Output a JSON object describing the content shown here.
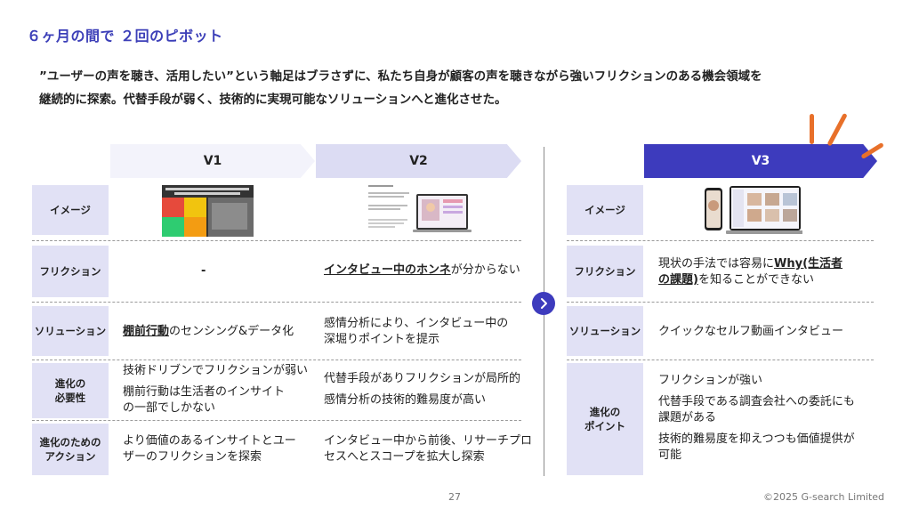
{
  "title": "６ヶ月の間で ２回のピボット",
  "intro": {
    "line1": "”ユーザーの声を聴き、活用したい”という軸足はブラさずに、私たち自身が顧客の声を聴きながら強いフリクションのある機会領域を",
    "line2": "継続的に探索。代替手段が弱く、技術的に実現可能なソリューションへと進化させた。"
  },
  "columns": {
    "v1": "V1",
    "v2": "V2",
    "v3": "V3"
  },
  "left_labels": {
    "image": "イメージ",
    "friction": "フリクション",
    "solution": "ソリューション",
    "necessity_1": "進化の",
    "necessity_2": "必要性",
    "action_1": "進化のための",
    "action_2": "アクション"
  },
  "right_labels": {
    "image": "イメージ",
    "friction": "フリクション",
    "solution": "ソリューション",
    "point_1": "進化の",
    "point_2": "ポイント"
  },
  "v1": {
    "friction": "-",
    "solution_strong": "棚前行動",
    "solution_rest": "のセンシング&データ化",
    "necessity_1": "技術ドリブンでフリクションが弱い",
    "necessity_2a": "棚前行動は生活者のインサイト",
    "necessity_2b": "の一部でしかない",
    "action_a": "より価値のあるインサイトとユー",
    "action_b": "ザーのフリクションを探索"
  },
  "v2": {
    "friction_strong": "インタビュー中のホンネ",
    "friction_rest": "が分からない",
    "solution_a": "感情分析により、インタビュー中の",
    "solution_b": "深堀りポイントを提示",
    "necessity_1": "代替手段がありフリクションが局所的",
    "necessity_2": "感情分析の技術的難易度が高い",
    "action_a": "インタビュー中から前後、リサーチプロ",
    "action_b": "セスへとスコープを拡大し探索"
  },
  "v3": {
    "friction_a_pre": "現状の手法では容易に",
    "friction_a_strong": "Why(生活者",
    "friction_b_strong": "の課題)",
    "friction_b_rest": "を知ることができない",
    "solution": "クイックなセルフ動画インタビュー",
    "point_1": "フリクションが強い",
    "point_2a": "代替手段である調査会社への委託にも",
    "point_2b": "課題がある",
    "point_3a": "技術的難易度を抑えつつも価値提供が",
    "point_3b": "可能"
  },
  "footer": {
    "page": "27",
    "copyright": "©2025 G-search Limited"
  },
  "colors": {
    "accent": "#3d3bbd",
    "label_bg": "#e1e1f5",
    "orange": "#e8702a"
  },
  "icons": {
    "next": "chevron-right-icon"
  }
}
